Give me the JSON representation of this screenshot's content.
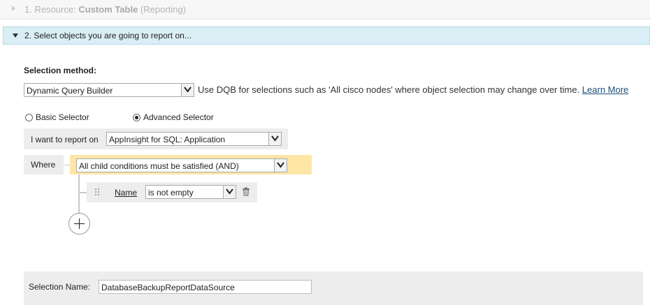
{
  "step1": {
    "prefix": "1. Resource:",
    "name": "Custom Table",
    "suffix": "(Reporting)"
  },
  "step2": {
    "title": "2. Select objects you are going to report on..."
  },
  "selection_method": {
    "label": "Selection method:",
    "value": "Dynamic Query Builder",
    "hint": "Use DQB for selections such as 'All cisco nodes' where object selection may change over time.",
    "learn_more": "Learn More"
  },
  "selector": {
    "basic_label": "Basic Selector",
    "advanced_label": "Advanced Selector",
    "selected": "advanced"
  },
  "report_on": {
    "label": "I want to report on",
    "value": "AppInsight for SQL: Application"
  },
  "where": {
    "label": "Where",
    "condition_group": "All child conditions must be satisfied (AND)"
  },
  "condition": {
    "field": "Name",
    "operator": "is not empty"
  },
  "selection_name": {
    "label": "Selection Name:",
    "value": "DatabaseBackupReportDataSource"
  },
  "colors": {
    "step2_bg": "#daeef5",
    "where_bg": "#fde6a6",
    "condition_bg": "#ededed",
    "link": "#1a4d7a"
  }
}
